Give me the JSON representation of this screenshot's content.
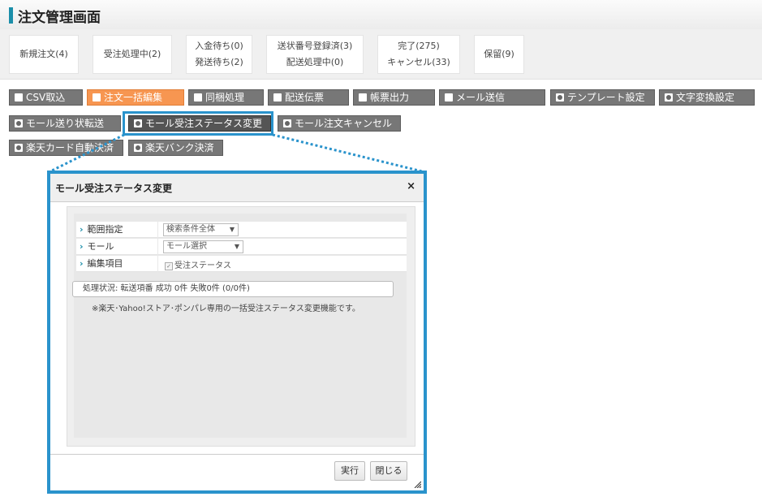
{
  "header": {
    "title": "注文管理画面"
  },
  "status_tabs": [
    {
      "lines": [
        "新規注文(4)"
      ]
    },
    {
      "lines": [
        "受注処理中(2)"
      ]
    },
    {
      "lines": [
        "入金待ち(0)",
        "発送待ち(2)"
      ]
    },
    {
      "lines": [
        "送状番号登録済(3)",
        "配送処理中(0)"
      ]
    },
    {
      "lines": [
        "完了(275)",
        "キャンセル(33)"
      ]
    },
    {
      "lines": [
        "保留(9)"
      ]
    }
  ],
  "toolbar": {
    "row1": [
      "CSV取込",
      "注文一括編集",
      "同梱処理",
      "配送伝票",
      "帳票出力",
      "メール送信",
      "テンプレート設定",
      "文字変換設定"
    ],
    "row2": [
      "モール送り状転送",
      "モール受注ステータス変更",
      "モール注文キャンセル"
    ],
    "row3": [
      "楽天カード自動決済",
      "楽天バンク決済"
    ],
    "icons": [
      "download-icon",
      "square-icon",
      "calendar-icon",
      "spreadsheet-icon",
      "pdf-icon",
      "mail-icon",
      "gear-icon",
      "gear-icon"
    ],
    "accent_color": "#f79651",
    "highlight_color": "#2a93cc"
  },
  "dialog": {
    "title": "モール受注ステータス変更",
    "close_label": "×",
    "fields": [
      {
        "label": "範囲指定",
        "type": "select",
        "value": "検索条件全体"
      },
      {
        "label": "モール",
        "type": "select",
        "value": "モール選択"
      },
      {
        "label": "編集項目",
        "type": "checkbox",
        "value": "受注ステータス",
        "checked": true
      }
    ],
    "process_status": "処理状況: 転送項番 成功 0件 失敗0件 (0/0件)",
    "note": "※楽天･Yahoo!ストア･ポンパレ専用の一括受注ステータス変更機能です。",
    "buttons": {
      "run": "実行",
      "close": "閉じる"
    }
  }
}
